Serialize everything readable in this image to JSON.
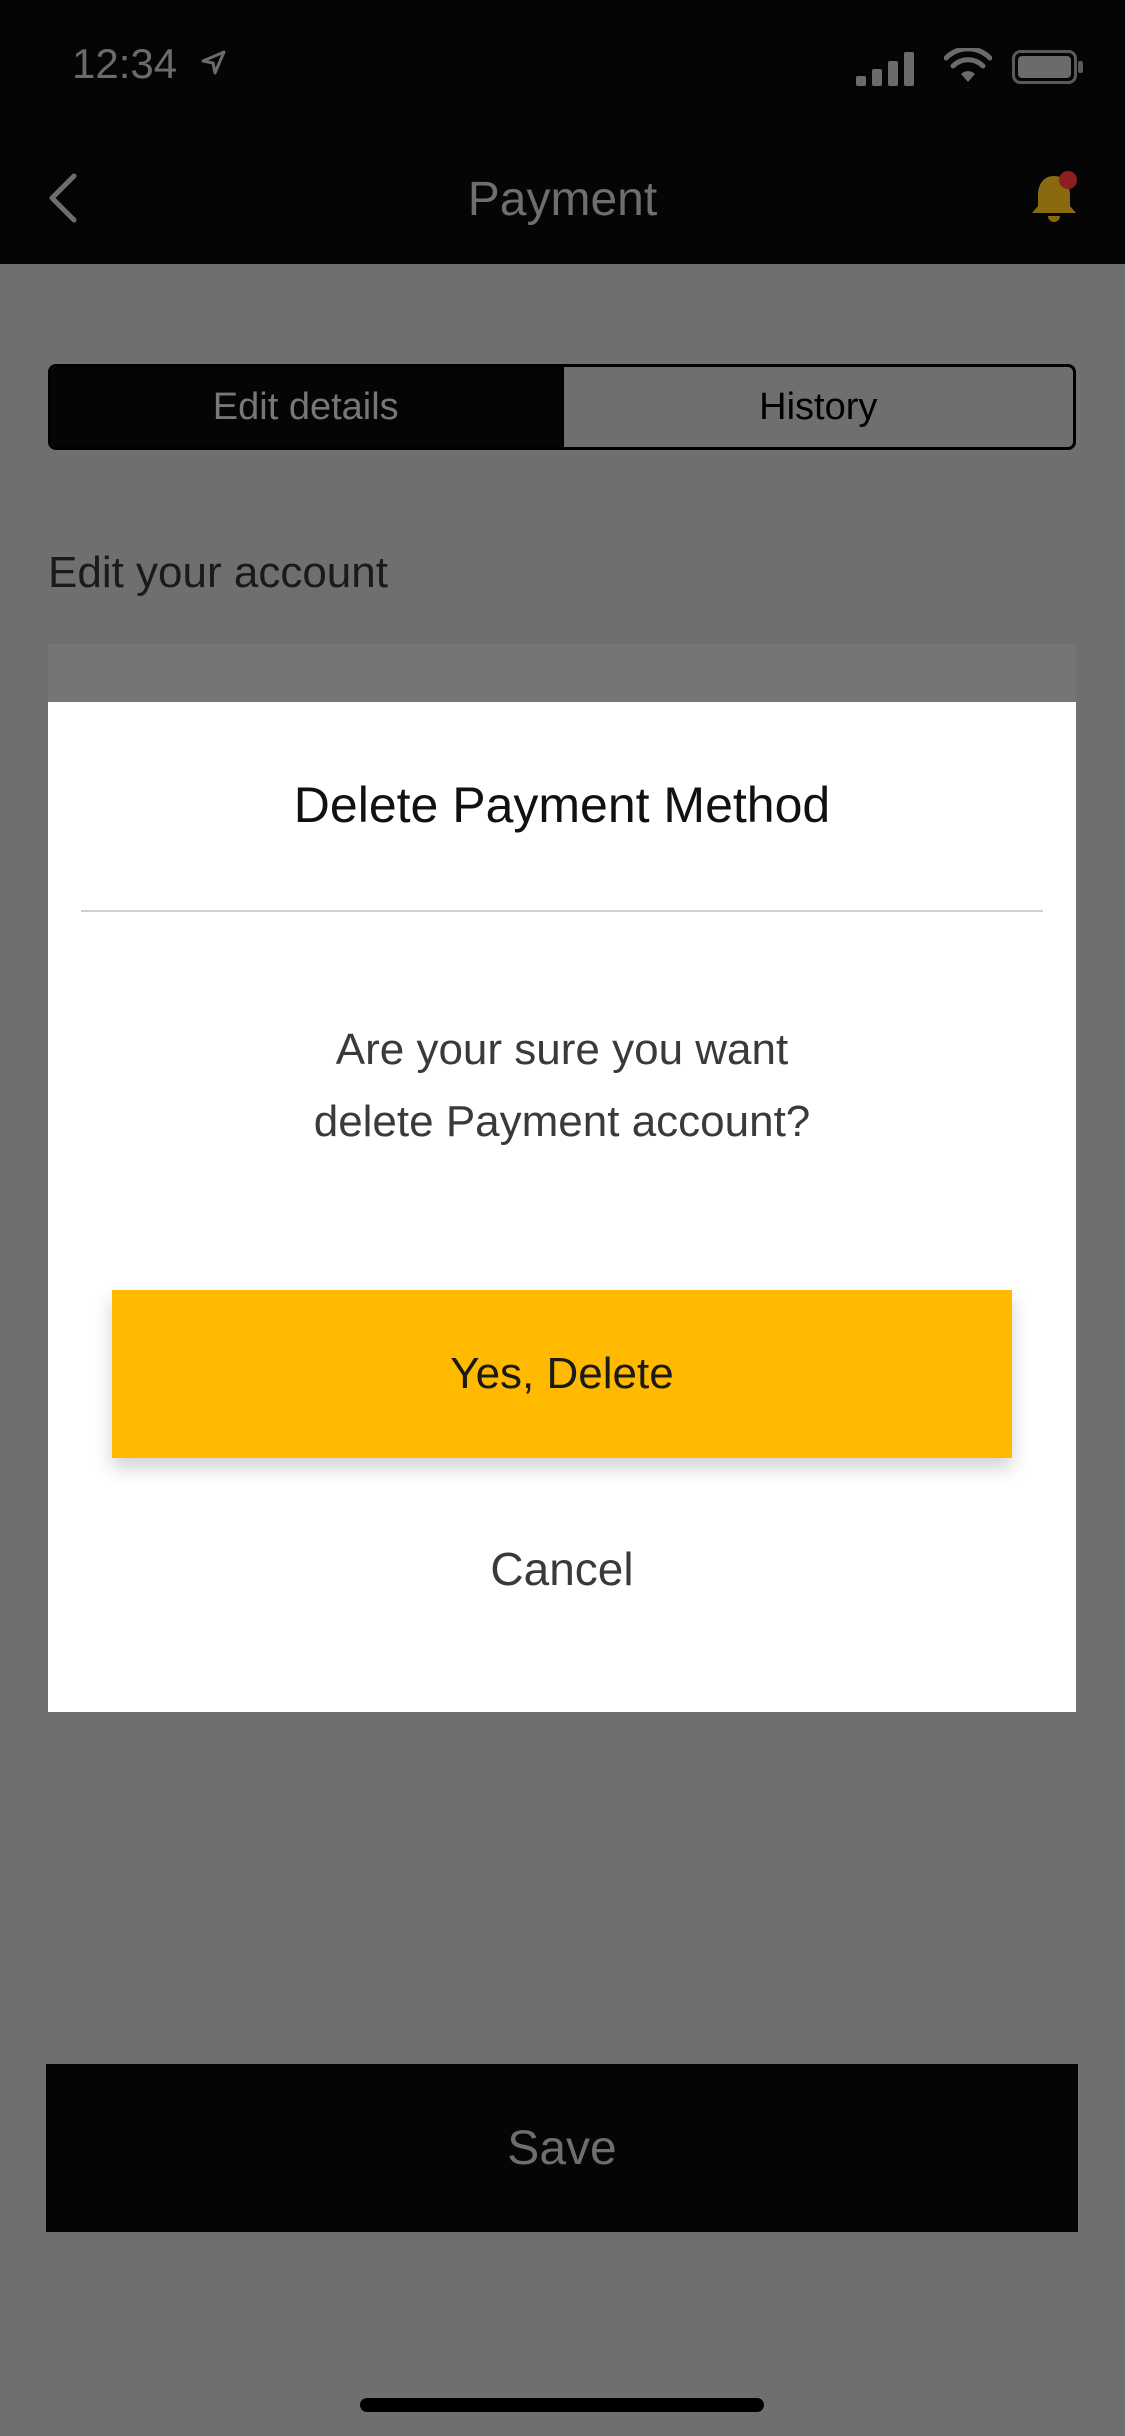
{
  "status_bar": {
    "time": "12:34",
    "icons": [
      "location-arrow-icon",
      "cellular-signal-icon",
      "wifi-icon",
      "battery-icon"
    ]
  },
  "nav": {
    "title": "Payment",
    "back_icon": "chevron-left-icon",
    "notification_icon": "bell-icon"
  },
  "tabs": [
    {
      "label": "Edit details",
      "active": true
    },
    {
      "label": "History",
      "active": false
    }
  ],
  "section": {
    "title": "Edit your account"
  },
  "modal": {
    "title": "Delete Payment Method",
    "message_line1": "Are your sure you want",
    "message_line2": "delete Payment account?",
    "confirm_label": "Yes, Delete",
    "cancel_label": "Cancel"
  },
  "footer": {
    "save_label": "Save"
  },
  "colors": {
    "accent": "#FFBA00",
    "dark": "#050505",
    "overlay": "#6F6F6F",
    "notification_badge": "#D9222A"
  }
}
